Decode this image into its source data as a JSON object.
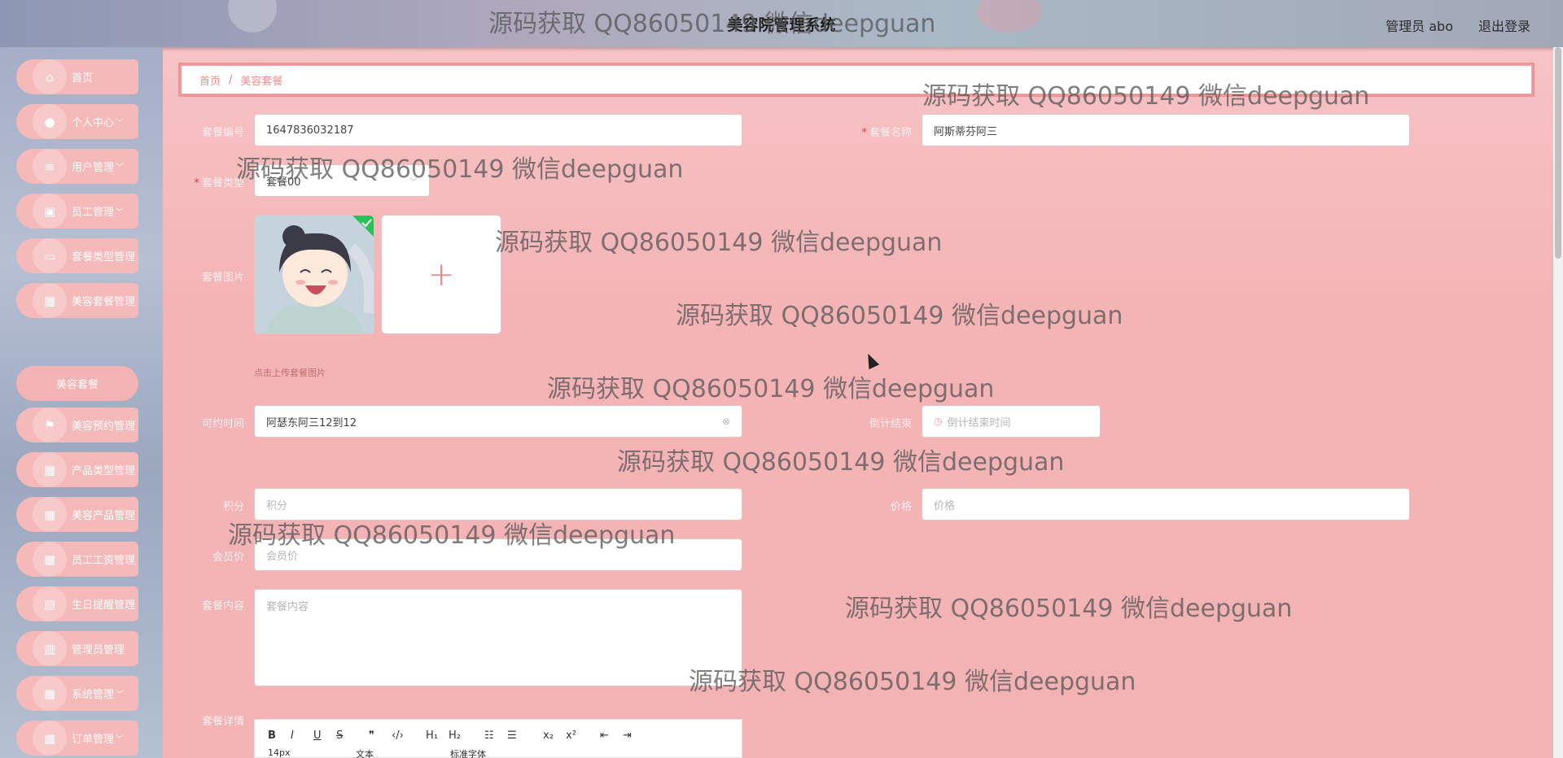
{
  "app": {
    "title": "美容院管理系统",
    "user": "管理员 abo",
    "logout": "退出登录"
  },
  "sidebar": {
    "items": [
      {
        "label": "首页",
        "icon": "home-icon",
        "chev": ""
      },
      {
        "label": "个人中心",
        "icon": "user-icon",
        "chev": "﹀"
      },
      {
        "label": "用户管理",
        "icon": "menu-icon",
        "chev": "﹀"
      },
      {
        "label": "员工管理",
        "icon": "card-icon",
        "chev": "﹀"
      },
      {
        "label": "套餐类型管理",
        "icon": "monitor-icon",
        "chev": ""
      },
      {
        "label": "美容套餐管理",
        "icon": "grid-icon",
        "chev": ""
      },
      {
        "label": "美容预约管理",
        "icon": "flag-icon",
        "chev": ""
      },
      {
        "label": "产品类型管理",
        "icon": "grid-icon",
        "chev": ""
      },
      {
        "label": "美容产品管理",
        "icon": "grid-icon",
        "chev": ""
      },
      {
        "label": "员工工资管理",
        "icon": "grid-icon",
        "chev": ""
      },
      {
        "label": "生日提醒管理",
        "icon": "calendar-icon",
        "chev": ""
      },
      {
        "label": "管理员管理",
        "icon": "clipboard-icon",
        "chev": ""
      },
      {
        "label": "系统管理",
        "icon": "grid-icon",
        "chev": "﹀"
      },
      {
        "label": "订单管理",
        "icon": "grid-icon",
        "chev": "﹀"
      }
    ],
    "sub_active": "美容套餐"
  },
  "breadcrumb": {
    "home": "首页",
    "sep": "/",
    "current": "美容套餐"
  },
  "form": {
    "code_label": "套餐编号",
    "code_value": "1647836032187",
    "name_label": "套餐名称",
    "name_value": "阿斯蒂芬阿三",
    "type_label": "套餐类型",
    "type_value": "套餐00",
    "image_label": "套餐图片",
    "upload_plus": "+",
    "upload_hint": "点击上传套餐图片",
    "time_label": "可约时间",
    "time_value": "阿瑟东阿三12到12",
    "countdown_label": "倒计结束",
    "countdown_placeholder": "倒计结束时间",
    "points_label": "积分",
    "points_placeholder": "积分",
    "price_label": "价格",
    "price_placeholder": "价格",
    "member_price_label": "会员价",
    "member_price_placeholder": "会员价",
    "content_label": "套餐内容",
    "content_placeholder": "套餐内容",
    "detail_label": "套餐详情"
  },
  "editor": {
    "buttons": [
      "B",
      "I",
      "U",
      "S",
      "❞",
      "‹/›",
      "H₁",
      "H₂",
      "☷",
      "☰",
      "x₂",
      "x²",
      "⇤",
      "⇥"
    ],
    "font_size": "14px",
    "text_format": "文本",
    "font_family": "标准字体"
  },
  "watermark": "源码获取 QQ86050149 微信deepguan"
}
